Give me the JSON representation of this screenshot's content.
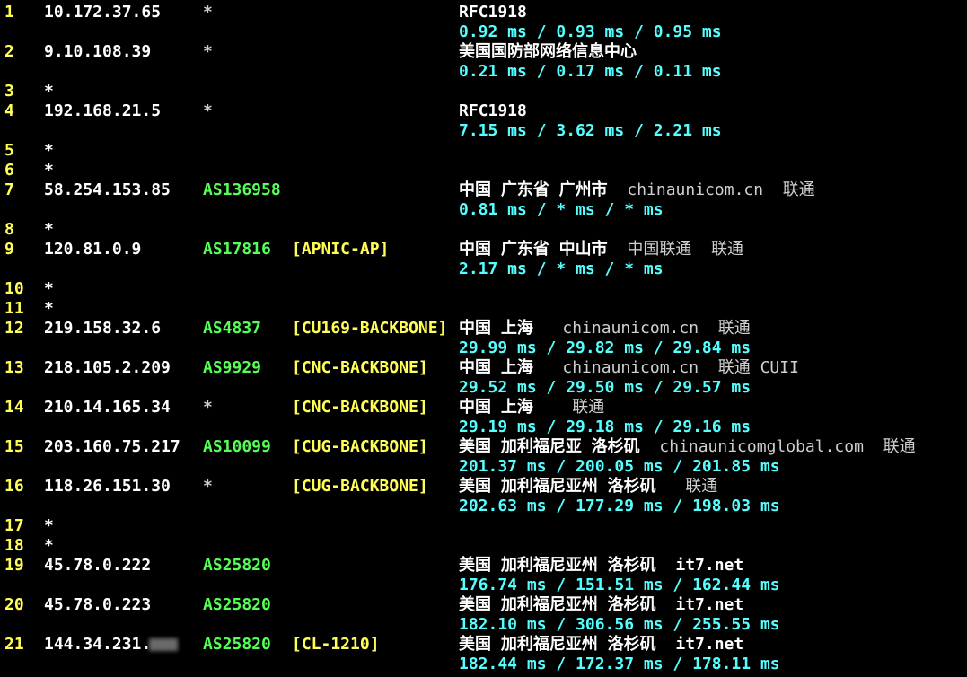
{
  "hops": [
    {
      "hop": "1",
      "ip": "10.172.37.65",
      "as": "*",
      "net": "",
      "geo": "RFC1918",
      "geo_extra": "",
      "rtt": "0.92 ms / 0.93 ms / 0.95 ms"
    },
    {
      "hop": "2",
      "ip": "9.10.108.39",
      "as": "*",
      "net": "",
      "geo": "美国国防部网络信息中心",
      "geo_extra": "",
      "rtt": "0.21 ms / 0.17 ms / 0.11 ms"
    },
    {
      "hop": "3",
      "ip": "*",
      "as": "",
      "net": "",
      "geo": "",
      "geo_extra": "",
      "rtt": ""
    },
    {
      "hop": "4",
      "ip": "192.168.21.5",
      "as": "*",
      "net": "",
      "geo": "RFC1918",
      "geo_extra": "",
      "rtt": "7.15 ms / 3.62 ms / 2.21 ms"
    },
    {
      "hop": "5",
      "ip": "*",
      "as": "",
      "net": "",
      "geo": "",
      "geo_extra": "",
      "rtt": ""
    },
    {
      "hop": "6",
      "ip": "*",
      "as": "",
      "net": "",
      "geo": "",
      "geo_extra": "",
      "rtt": ""
    },
    {
      "hop": "7",
      "ip": "58.254.153.85",
      "as": "AS136958",
      "net": "",
      "geo": "中国 广东省 广州市",
      "geo_extra": "  chinaunicom.cn  联通",
      "rtt": "0.81 ms / * ms / * ms"
    },
    {
      "hop": "8",
      "ip": "*",
      "as": "",
      "net": "",
      "geo": "",
      "geo_extra": "",
      "rtt": ""
    },
    {
      "hop": "9",
      "ip": "120.81.0.9",
      "as": "AS17816",
      "net": "[APNIC-AP]",
      "geo": "中国 广东省 中山市",
      "geo_extra": "  中国联通  联通",
      "rtt": "2.17 ms / * ms / * ms"
    },
    {
      "hop": "10",
      "ip": "*",
      "as": "",
      "net": "",
      "geo": "",
      "geo_extra": "",
      "rtt": ""
    },
    {
      "hop": "11",
      "ip": "*",
      "as": "",
      "net": "",
      "geo": "",
      "geo_extra": "",
      "rtt": ""
    },
    {
      "hop": "12",
      "ip": "219.158.32.6",
      "as": "AS4837",
      "net": "[CU169-BACKBONE]",
      "geo": "中国 上海",
      "geo_extra": "   chinaunicom.cn  联通",
      "rtt": "29.99 ms / 29.82 ms / 29.84 ms"
    },
    {
      "hop": "13",
      "ip": "218.105.2.209",
      "as": "AS9929",
      "net": "[CNC-BACKBONE]",
      "geo": "中国 上海",
      "geo_extra": "   chinaunicom.cn  联通 CUII",
      "rtt": "29.52 ms / 29.50 ms / 29.57 ms"
    },
    {
      "hop": "14",
      "ip": "210.14.165.34",
      "as": "*",
      "net": "[CNC-BACKBONE]",
      "geo": "中国 上海",
      "geo_extra": "    联通",
      "rtt": "29.19 ms / 29.18 ms / 29.16 ms"
    },
    {
      "hop": "15",
      "ip": "203.160.75.217",
      "as": "AS10099",
      "net": "[CUG-BACKBONE]",
      "geo": "美国 加利福尼亚 洛杉矶",
      "geo_extra": "  chinaunicomglobal.com  联通",
      "rtt": "201.37 ms / 200.05 ms / 201.85 ms"
    },
    {
      "hop": "16",
      "ip": "118.26.151.30",
      "as": "*",
      "net": "[CUG-BACKBONE]",
      "geo": "美国 加利福尼亚州 洛杉矶",
      "geo_extra": "   联通",
      "rtt": "202.63 ms / 177.29 ms / 198.03 ms"
    },
    {
      "hop": "17",
      "ip": "*",
      "as": "",
      "net": "",
      "geo": "",
      "geo_extra": "",
      "rtt": ""
    },
    {
      "hop": "18",
      "ip": "*",
      "as": "",
      "net": "",
      "geo": "",
      "geo_extra": "",
      "rtt": ""
    },
    {
      "hop": "19",
      "ip": "45.78.0.222",
      "as": "AS25820",
      "net": "",
      "geo": "美国 加利福尼亚州 洛杉矶",
      "geo_extra": "  it7.net",
      "rtt": "176.74 ms / 151.51 ms / 162.44 ms"
    },
    {
      "hop": "20",
      "ip": "45.78.0.223",
      "as": "AS25820",
      "net": "",
      "geo": "美国 加利福尼亚州 洛杉矶",
      "geo_extra": "  it7.net",
      "rtt": "182.10 ms / 306.56 ms / 255.55 ms"
    },
    {
      "hop": "21",
      "ip": "144.34.231.",
      "as": "AS25820",
      "net": "[CL-1210]",
      "geo": "美国 加利福尼亚州 洛杉矶",
      "geo_extra": "  it7.net",
      "rtt": "182.44 ms / 172.37 ms / 178.11 ms"
    }
  ]
}
